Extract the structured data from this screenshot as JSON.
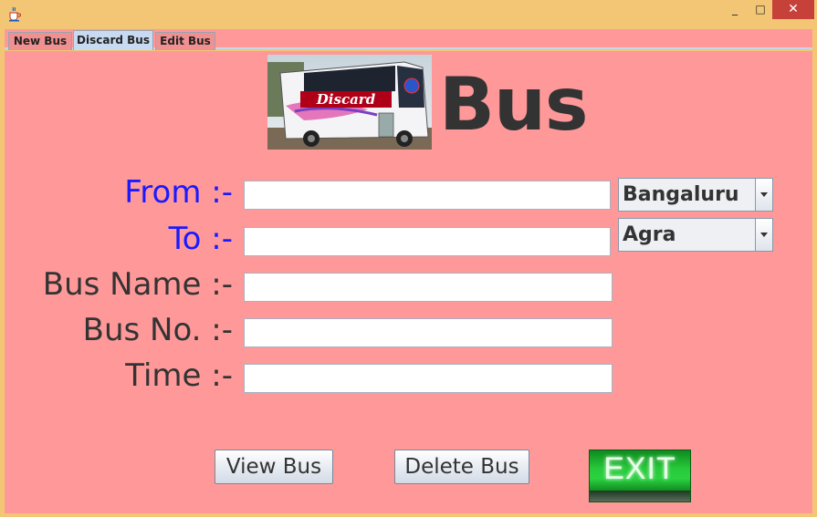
{
  "window": {
    "icon": "java-cup-icon",
    "controls": {
      "minimize": "_",
      "maximize": "□",
      "close": "✕"
    }
  },
  "tabs": [
    {
      "label": "New Bus",
      "active": false
    },
    {
      "label": "Discard Bus",
      "active": true
    },
    {
      "label": "Edit Bus",
      "active": false
    }
  ],
  "header": {
    "image_caption": "Discard",
    "title": "Bus"
  },
  "form": {
    "from_label": "From :-",
    "to_label": "To :-",
    "bus_name_label": "Bus Name :-",
    "bus_no_label": "Bus No. :-",
    "time_label": "Time :-",
    "from_value": "",
    "to_value": "",
    "bus_name_value": "",
    "bus_no_value": "",
    "time_value": "",
    "from_city": "Bangaluru",
    "to_city": "Agra"
  },
  "buttons": {
    "view": "View Bus",
    "delete": "Delete Bus",
    "exit": "EXIT"
  },
  "colors": {
    "panel_bg": "#ff9999",
    "frame": "#f2c675",
    "label_blue": "#1a1aff",
    "label_dark": "#333333",
    "exit_green": "#27c93a"
  }
}
